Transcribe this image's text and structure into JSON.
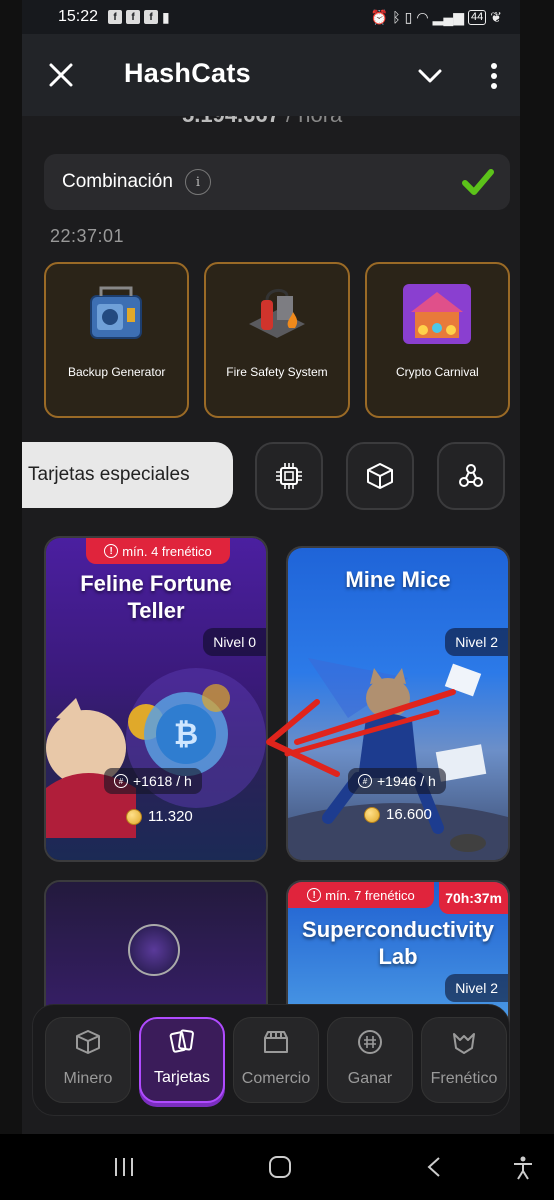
{
  "status_bar": {
    "time": "15:22",
    "battery": "44"
  },
  "header": {
    "title": "HashCats"
  },
  "profit_partial": {
    "value": "5.194.667",
    "unit": "/ hora"
  },
  "combo": {
    "label": "Combinación",
    "info": "i"
  },
  "countdown": "22:37:01",
  "combo_cards": [
    {
      "label": "Backup Generator"
    },
    {
      "label": "Fire Safety System"
    },
    {
      "label": "Crypto Carnival"
    }
  ],
  "tabs": {
    "special_label": "Tarjetas especiales"
  },
  "cards": [
    {
      "title": "Feline Fortune Teller",
      "requirement": "mín. 4 frenético",
      "level": "Nivel 0",
      "rate": "+1618 / h",
      "price": "11.320"
    },
    {
      "title": "Mine Mice",
      "level": "Nivel 2",
      "rate": "+1946 / h",
      "price": "16.600"
    },
    {
      "title": ""
    },
    {
      "title": "Superconductivity Lab",
      "requirement": "mín. 7 frenético",
      "timer": "70h:37m",
      "level": "Nivel 2"
    }
  ],
  "nav": {
    "items": [
      {
        "label": "Minero"
      },
      {
        "label": "Tarjetas",
        "active": true
      },
      {
        "label": "Comercio"
      },
      {
        "label": "Ganar"
      },
      {
        "label": "Frenético"
      }
    ]
  },
  "colors": {
    "accent": "#b04bff",
    "badge_red": "#e0243c",
    "card_border": "#9a6a26"
  }
}
